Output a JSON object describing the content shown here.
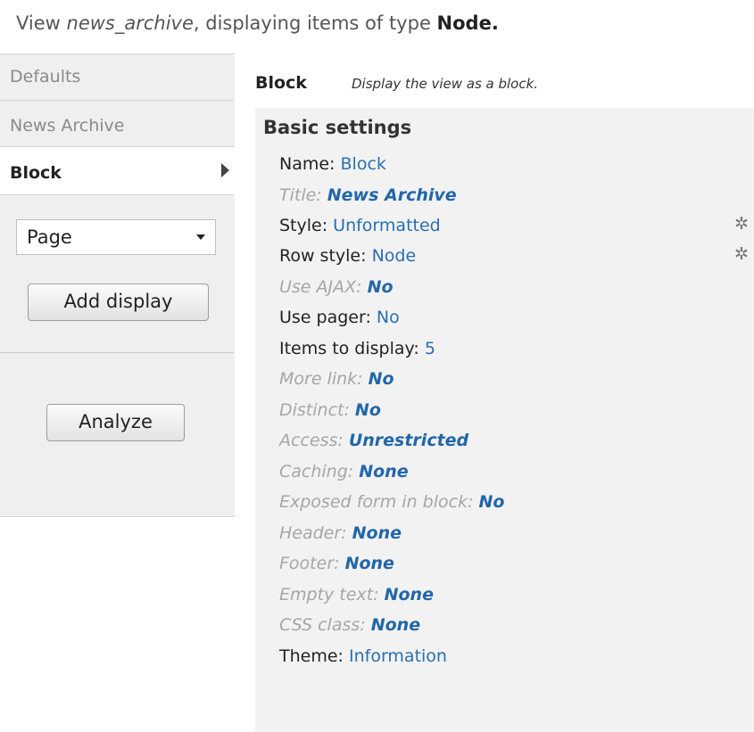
{
  "header": {
    "prefix": "View ",
    "view_name": "news_archive",
    "middle": ", displaying items of type ",
    "item_type": "Node."
  },
  "tabs": [
    {
      "label": "Defaults"
    },
    {
      "label": "News Archive"
    },
    {
      "label": "Block"
    }
  ],
  "add_display": {
    "select_value": "Page",
    "button_label": "Add display"
  },
  "analyze_label": "Analyze",
  "display": {
    "title": "Block",
    "description": "Display the view as a block."
  },
  "basic_settings": {
    "title": "Basic settings",
    "items": [
      {
        "label": "Name: ",
        "value": "Block"
      },
      {
        "label": "Title: ",
        "value": "News Archive"
      },
      {
        "label": "Style: ",
        "value": "Unformatted"
      },
      {
        "label": "Row style: ",
        "value": "Node"
      },
      {
        "label": "Use AJAX: ",
        "value": "No"
      },
      {
        "label": "Use pager: ",
        "value": "No"
      },
      {
        "label": "Items to display: ",
        "value": "5"
      },
      {
        "label": "More link: ",
        "value": "No"
      },
      {
        "label": "Distinct: ",
        "value": "No"
      },
      {
        "label": "Access: ",
        "value": "Unrestricted"
      },
      {
        "label": "Caching: ",
        "value": "None"
      },
      {
        "label": "Exposed form in block: ",
        "value": "No"
      },
      {
        "label": "Header: ",
        "value": "None"
      },
      {
        "label": "Footer: ",
        "value": "None"
      },
      {
        "label": "Empty text: ",
        "value": "None"
      },
      {
        "label": "CSS class: ",
        "value": "None"
      },
      {
        "label": "Theme: ",
        "value": "Information"
      }
    ]
  },
  "icons": {
    "gear": "gear-icon",
    "tab_arrow": "arrow-right-icon",
    "select_caret": "chevron-down-icon"
  }
}
